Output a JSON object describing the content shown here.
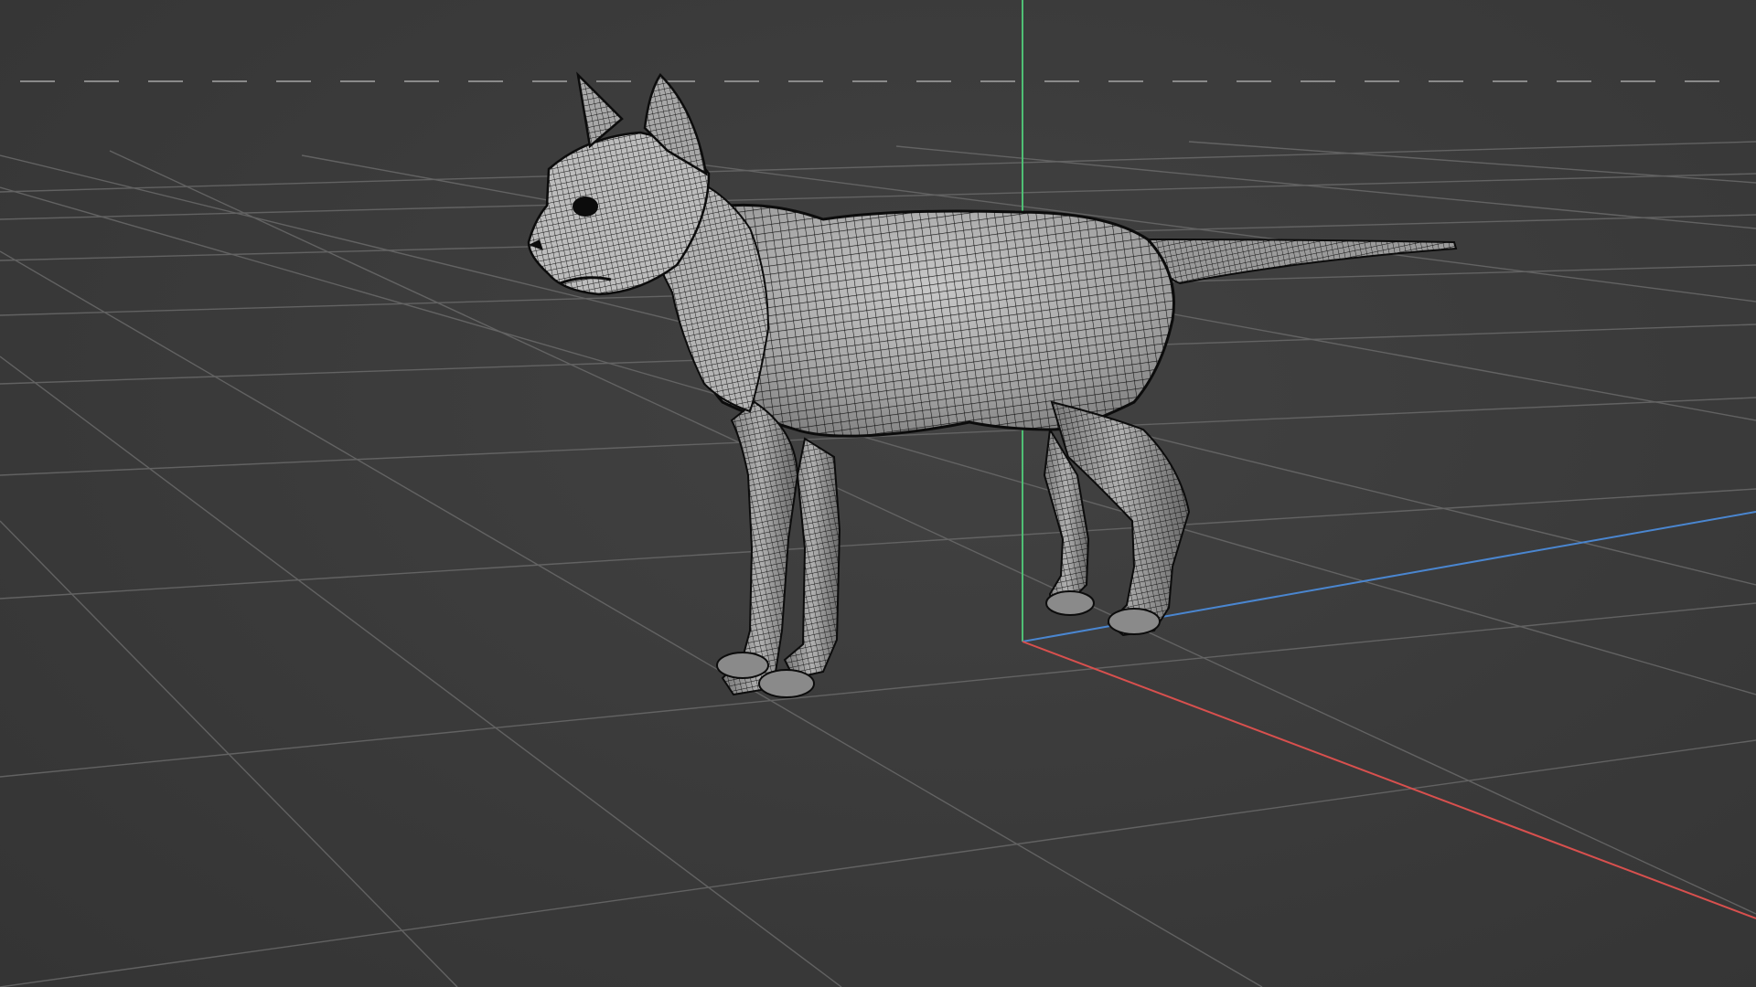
{
  "app": {
    "view": "3d-viewport",
    "display_mode": "wireframe-on-shaded"
  },
  "scene": {
    "object": "cat-mesh",
    "object_color": "#a9a9a9",
    "wire_color": "#111111"
  },
  "colors": {
    "background": "#3a3a3a",
    "grid": "#6a6a6a",
    "horizon_dash": "#8a8a8a",
    "axis_x": "#d8504e",
    "axis_y": "#4a86d0",
    "axis_z": "#4fbf74"
  },
  "icons": {
    "axis_gizmo": "world-axes-icon"
  }
}
